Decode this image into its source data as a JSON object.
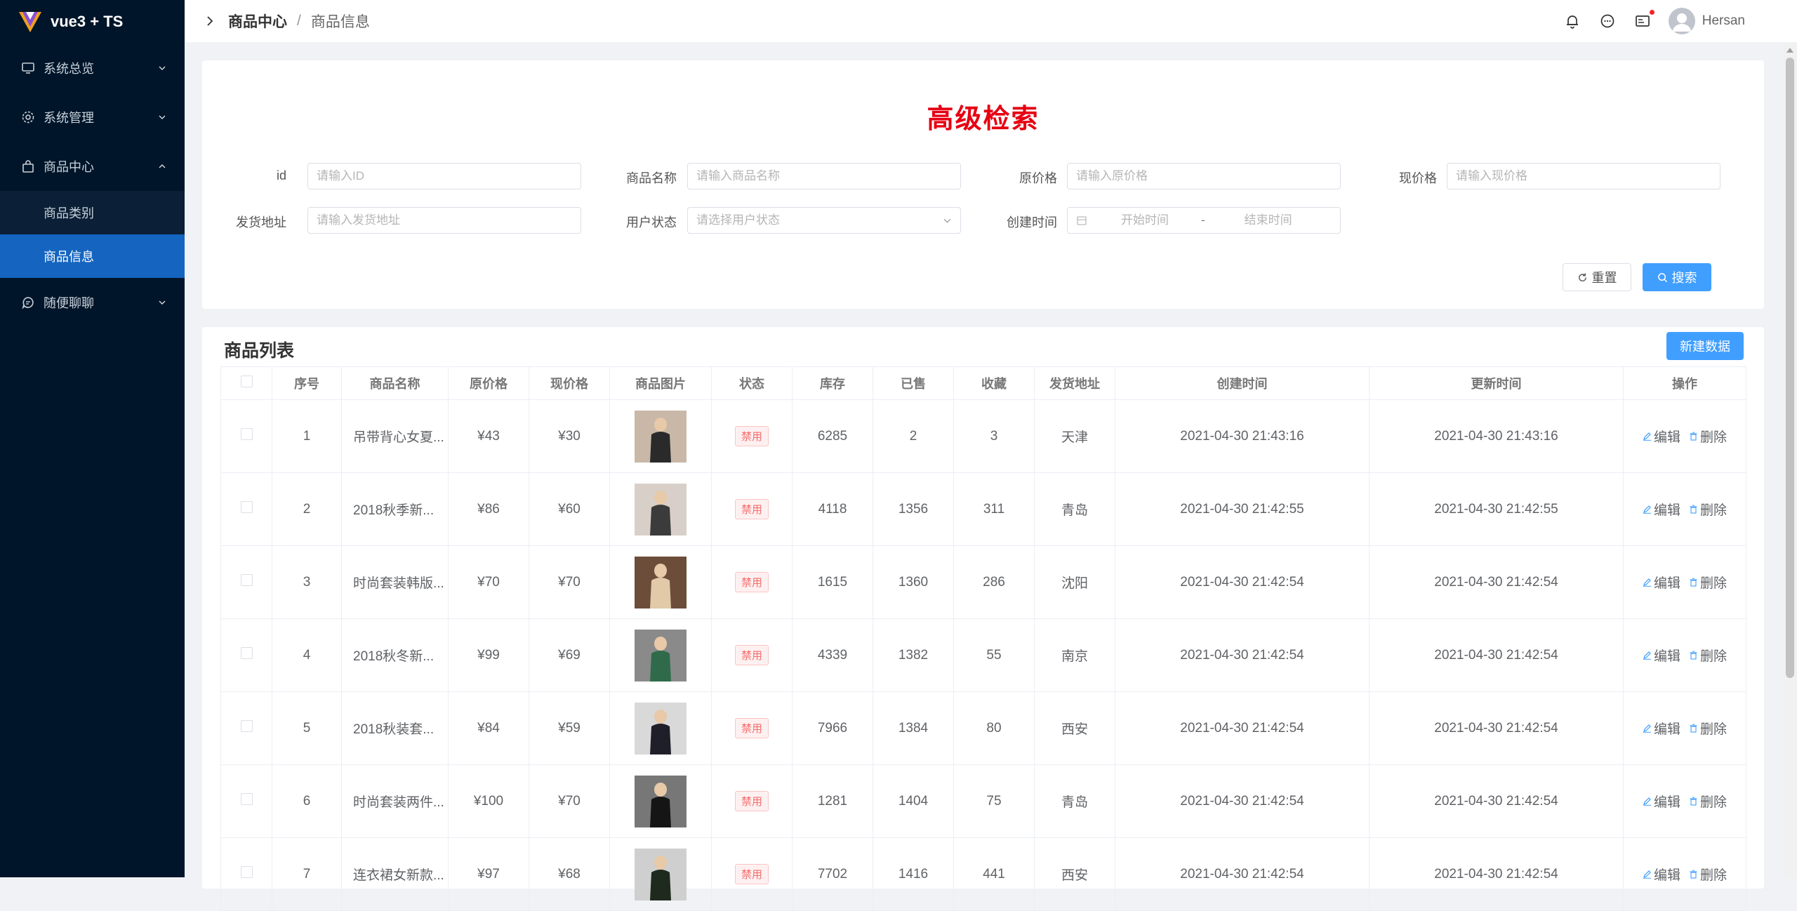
{
  "app": {
    "title": "vue3 + TS"
  },
  "sidebar": {
    "items": [
      {
        "label": "系统总览",
        "icon": "monitor-icon",
        "expanded": false
      },
      {
        "label": "系统管理",
        "icon": "gear-icon",
        "expanded": false
      },
      {
        "label": "商品中心",
        "icon": "bag-icon",
        "expanded": true,
        "children": [
          {
            "label": "商品类别",
            "active": false
          },
          {
            "label": "商品信息",
            "active": true
          }
        ]
      },
      {
        "label": "随便聊聊",
        "icon": "chat-icon",
        "expanded": false
      }
    ]
  },
  "header": {
    "breadcrumb": [
      "商品中心",
      "商品信息"
    ],
    "breadcrumb_sep": "/",
    "username": "Hersan"
  },
  "search": {
    "title": "高级检索",
    "fields": {
      "id": {
        "label": "id",
        "placeholder": "请输入ID"
      },
      "name": {
        "label": "商品名称",
        "placeholder": "请输入商品名称"
      },
      "old_price": {
        "label": "原价格",
        "placeholder": "请输入原价格"
      },
      "new_price": {
        "label": "现价格",
        "placeholder": "请输入现价格"
      },
      "address": {
        "label": "发货地址",
        "placeholder": "请输入发货地址"
      },
      "status": {
        "label": "用户状态",
        "placeholder": "请选择用户状态"
      },
      "created": {
        "label": "创建时间",
        "start_placeholder": "开始时间",
        "end_placeholder": "结束时间",
        "range_sep": "-"
      }
    },
    "reset_label": "重置",
    "search_label": "搜索"
  },
  "list": {
    "title": "商品列表",
    "new_label": "新建数据",
    "columns": [
      "序号",
      "商品名称",
      "原价格",
      "现价格",
      "商品图片",
      "状态",
      "库存",
      "已售",
      "收藏",
      "发货地址",
      "创建时间",
      "更新时间",
      "操作"
    ],
    "edit_label": "编辑",
    "delete_label": "删除",
    "rows": [
      {
        "index": "1",
        "name": "吊带背心女夏...",
        "old_price": "¥43",
        "new_price": "¥30",
        "status": "禁用",
        "stock": "6285",
        "sold": "2",
        "fav": "3",
        "address": "天津",
        "created": "2021-04-30 21:43:16",
        "updated": "2021-04-30 21:43:16"
      },
      {
        "index": "2",
        "name": "2018秋季新...",
        "old_price": "¥86",
        "new_price": "¥60",
        "status": "禁用",
        "stock": "4118",
        "sold": "1356",
        "fav": "311",
        "address": "青岛",
        "created": "2021-04-30 21:42:55",
        "updated": "2021-04-30 21:42:55"
      },
      {
        "index": "3",
        "name": "时尚套装韩版...",
        "old_price": "¥70",
        "new_price": "¥70",
        "status": "禁用",
        "stock": "1615",
        "sold": "1360",
        "fav": "286",
        "address": "沈阳",
        "created": "2021-04-30 21:42:54",
        "updated": "2021-04-30 21:42:54"
      },
      {
        "index": "4",
        "name": "2018秋冬新...",
        "old_price": "¥99",
        "new_price": "¥69",
        "status": "禁用",
        "stock": "4339",
        "sold": "1382",
        "fav": "55",
        "address": "南京",
        "created": "2021-04-30 21:42:54",
        "updated": "2021-04-30 21:42:54"
      },
      {
        "index": "5",
        "name": "2018秋装套...",
        "old_price": "¥84",
        "new_price": "¥59",
        "status": "禁用",
        "stock": "7966",
        "sold": "1384",
        "fav": "80",
        "address": "西安",
        "created": "2021-04-30 21:42:54",
        "updated": "2021-04-30 21:42:54"
      },
      {
        "index": "6",
        "name": "时尚套装两件...",
        "old_price": "¥100",
        "new_price": "¥70",
        "status": "禁用",
        "stock": "1281",
        "sold": "1404",
        "fav": "75",
        "address": "青岛",
        "created": "2021-04-30 21:42:54",
        "updated": "2021-04-30 21:42:54"
      },
      {
        "index": "7",
        "name": "连衣裙女新款...",
        "old_price": "¥97",
        "new_price": "¥68",
        "status": "禁用",
        "stock": "7702",
        "sold": "1416",
        "fav": "441",
        "address": "西安",
        "created": "2021-04-30 21:42:54",
        "updated": "2021-04-30 21:42:54"
      }
    ]
  },
  "colors": {
    "sidebar_bg": "#001529",
    "active": "#1565c0",
    "primary": "#409eff",
    "title_red": "#e60012",
    "danger": "#f56c6c"
  }
}
